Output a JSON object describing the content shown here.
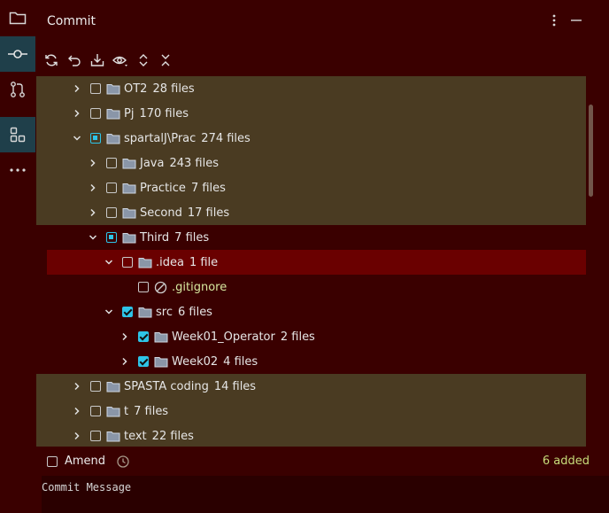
{
  "header": {
    "title": "Commit"
  },
  "sidebar": {
    "items": [
      {
        "icon": "folder-icon"
      },
      {
        "icon": "commit-icon",
        "active": true
      },
      {
        "icon": "pull-request-icon"
      },
      {
        "icon": "structure-icon",
        "active": true
      },
      {
        "icon": "more-icon"
      }
    ]
  },
  "toolbar": {
    "icons": [
      "refresh-icon",
      "rollback-icon",
      "shelve-icon",
      "preview-icon",
      "expand-all-icon",
      "collapse-all-icon"
    ]
  },
  "tree": {
    "rows": [
      {
        "name": "OT2",
        "count": "28 files",
        "depth": 0,
        "expanded": false,
        "check": "none",
        "hl": true
      },
      {
        "name": "Pj",
        "count": "170 files",
        "depth": 0,
        "expanded": false,
        "check": "none",
        "hl": true
      },
      {
        "name": "spartalJ\\Prac",
        "count": "274 files",
        "depth": 0,
        "expanded": true,
        "check": "partial",
        "hl": true
      },
      {
        "name": "Java",
        "count": "243 files",
        "depth": 1,
        "expanded": false,
        "check": "none",
        "hl": true
      },
      {
        "name": "Practice",
        "count": "7 files",
        "depth": 1,
        "expanded": false,
        "check": "none",
        "hl": true
      },
      {
        "name": "Second",
        "count": "17 files",
        "depth": 1,
        "expanded": false,
        "check": "none",
        "hl": true
      },
      {
        "name": "Third",
        "count": "7 files",
        "depth": 1,
        "expanded": true,
        "check": "partial",
        "hl": false
      },
      {
        "name": ".idea",
        "count": "1 file",
        "depth": 2,
        "expanded": true,
        "check": "none",
        "hl": false,
        "selected": true
      },
      {
        "name": ".gitignore",
        "count": "",
        "depth": 3,
        "leaf": true,
        "check": "none",
        "hl": false
      },
      {
        "name": "src",
        "count": "6 files",
        "depth": 2,
        "expanded": true,
        "check": "checked",
        "hl": false
      },
      {
        "name": "Week01_Operator",
        "count": "2 files",
        "depth": 3,
        "expanded": false,
        "check": "checked",
        "hl": false
      },
      {
        "name": "Week02",
        "count": "4 files",
        "depth": 3,
        "expanded": false,
        "check": "checked",
        "hl": false
      },
      {
        "name": "SPASTA coding",
        "count": "14 files",
        "depth": 0,
        "expanded": false,
        "check": "none",
        "hl": true
      },
      {
        "name": "t",
        "count": "7 files",
        "depth": 0,
        "expanded": false,
        "check": "none",
        "hl": true
      },
      {
        "name": "text",
        "count": "22 files",
        "depth": 0,
        "expanded": false,
        "check": "none",
        "hl": true
      }
    ]
  },
  "amend": {
    "label": "Amend",
    "added": "6 added"
  },
  "commit": {
    "placeholder": "Commit Message"
  },
  "colors": {
    "accent": "#2ec4e8",
    "highlight": "#4a3b22",
    "selected": "#6a0000",
    "background": "#3a0000"
  }
}
